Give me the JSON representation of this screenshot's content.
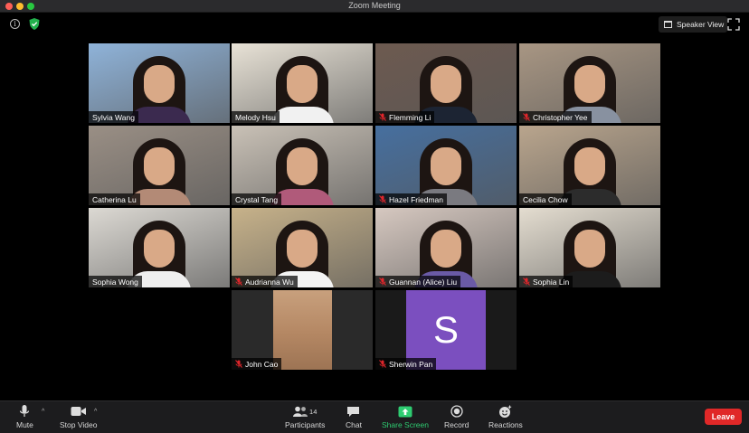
{
  "window": {
    "title": "Zoom Meeting"
  },
  "header": {
    "speaker_view_label": "Speaker View",
    "icons": [
      "info-icon",
      "shield-icon",
      "grid-icon",
      "fullscreen-icon"
    ]
  },
  "participants": [
    {
      "name": "Sylvia Wang",
      "muted": false,
      "active": false
    },
    {
      "name": "Melody Hsu",
      "muted": false,
      "active": true
    },
    {
      "name": "Flemming Li",
      "muted": true,
      "active": false
    },
    {
      "name": "Christopher Yee",
      "muted": true,
      "active": false
    },
    {
      "name": "Catherina Lu",
      "muted": false,
      "active": false
    },
    {
      "name": "Crystal Tang",
      "muted": false,
      "active": false
    },
    {
      "name": "Hazel Friedman",
      "muted": true,
      "active": false
    },
    {
      "name": "Cecilia Chow",
      "muted": false,
      "active": false
    },
    {
      "name": "Sophia Wong",
      "muted": false,
      "active": false
    },
    {
      "name": "Audrianna Wu",
      "muted": true,
      "active": false
    },
    {
      "name": "Guannan (Alice) Liu",
      "muted": true,
      "active": false
    },
    {
      "name": "Sophia Lin",
      "muted": true,
      "active": false
    },
    {
      "name": "John Cao",
      "muted": true,
      "active": false
    },
    {
      "name": "Sherwin Pan",
      "muted": true,
      "active": false,
      "avatar_letter": "S",
      "avatar_color": "#7b4fbf"
    }
  ],
  "toolbar": {
    "mute_label": "Mute",
    "stop_video_label": "Stop Video",
    "participants_label": "Participants",
    "participants_count": "14",
    "chat_label": "Chat",
    "share_screen_label": "Share Screen",
    "record_label": "Record",
    "reactions_label": "Reactions",
    "leave_label": "Leave"
  },
  "colors": {
    "active_speaker": "#b9e44b",
    "leave": "#e02828",
    "share": "#2ecc71",
    "muted_icon": "#e0262b"
  }
}
